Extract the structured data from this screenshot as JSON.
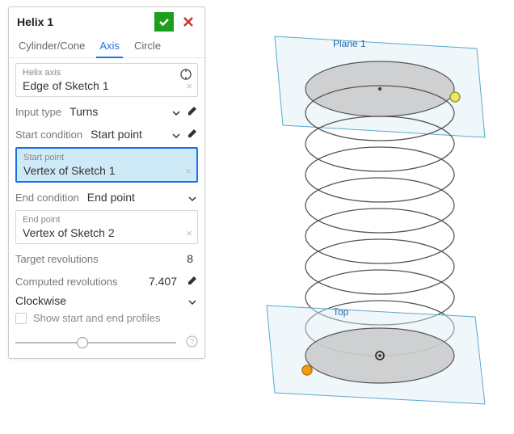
{
  "panel": {
    "title": "Helix 1",
    "tabs": {
      "cylinder": "Cylinder/Cone",
      "axis": "Axis",
      "circle": "Circle"
    },
    "helix_axis": {
      "label": "Helix axis",
      "value": "Edge of Sketch 1"
    },
    "input_type": {
      "label": "Input type",
      "value": "Turns"
    },
    "start_condition": {
      "label": "Start condition",
      "value": "Start point"
    },
    "start_point": {
      "label": "Start point",
      "value": "Vertex of Sketch 1"
    },
    "end_condition": {
      "label": "End condition",
      "value": "End point"
    },
    "end_point": {
      "label": "End point",
      "value": "Vertex of Sketch 2"
    },
    "target_revolutions": {
      "label": "Target revolutions",
      "value": "8"
    },
    "computed_revolutions": {
      "label": "Computed revolutions",
      "value": "7.407"
    },
    "direction": "Clockwise",
    "show_profiles": "Show start and end profiles"
  },
  "scene": {
    "plane_top_label": "Plane 1",
    "plane_bottom_label": "Top"
  }
}
